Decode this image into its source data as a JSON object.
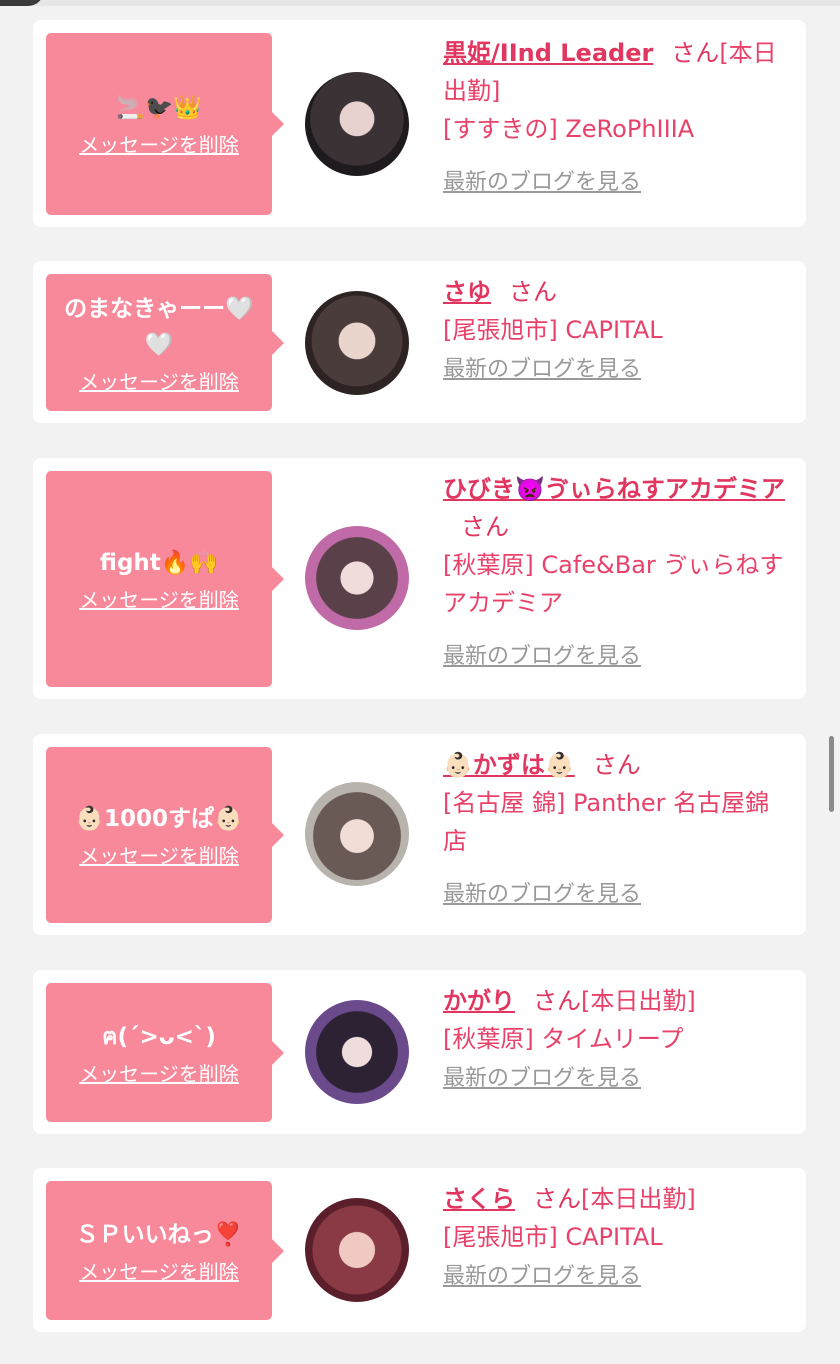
{
  "delete_label": "メッセージを削除",
  "blog_label": "最新のブログを見る",
  "honorific": "さん",
  "cards": [
    {
      "message": "🚬🐦‍⬛👑",
      "name": "黒姫/IInd Leader",
      "status": "[本日出勤]",
      "shop": "[すすきの] ZeRoPhIIIA"
    },
    {
      "message": "のまなきゃーー🤍🤍",
      "name": "さゆ",
      "status": "",
      "shop": "[尾張旭市] CAPITAL"
    },
    {
      "message": "fight🔥🙌",
      "name": "ひびき👿ゔぃらねすアカデミア",
      "status": "",
      "shop": "[秋葉原] Cafe&Bar ゔぃらねすアカデミア"
    },
    {
      "message": "👶🏻1000すぱ👶🏻",
      "name": "👶🏻かずは👶🏻",
      "status": "",
      "shop": "[名古屋 錦] Panther 名古屋錦店"
    },
    {
      "message": "ฅ(ˊ>ᴗ<ˋ)",
      "name": "かがり",
      "status": "[本日出勤]",
      "shop": "[秋葉原] タイムリープ"
    },
    {
      "message": "ＳＰいいねっ❣️",
      "name": "さくら",
      "status": "[本日出勤]",
      "shop": "[尾張旭市] CAPITAL"
    }
  ]
}
